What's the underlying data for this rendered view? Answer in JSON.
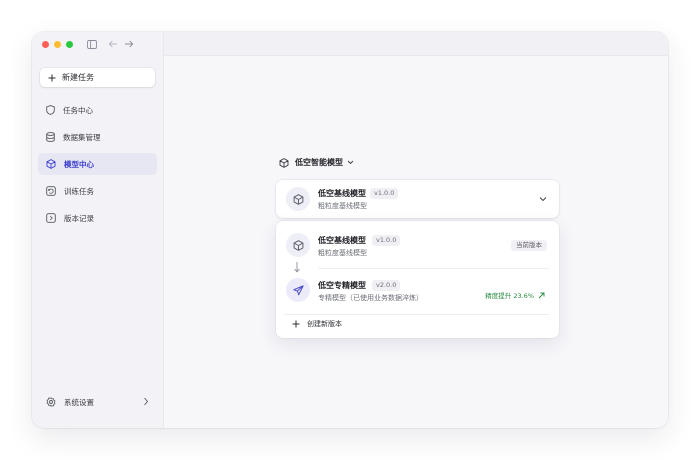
{
  "sidebar": {
    "new_task_label": "新建任务",
    "items": [
      {
        "label": "任务中心",
        "icon": "shield-icon"
      },
      {
        "label": "数据集管理",
        "icon": "database-icon"
      },
      {
        "label": "模型中心",
        "icon": "cube-icon",
        "active": true
      },
      {
        "label": "训练任务",
        "icon": "training-icon"
      },
      {
        "label": "版本记录",
        "icon": "document-icon"
      }
    ],
    "settings_label": "系统设置"
  },
  "model_selector": {
    "label": "低空智能模型"
  },
  "current_model": {
    "name": "低空基线模型",
    "version": "v1.0.0",
    "description": "粗粒度基线模型"
  },
  "versions": [
    {
      "name": "低空基线模型",
      "version": "v1.0.0",
      "description": "粗粒度基线模型",
      "badge": "当前版本"
    },
    {
      "name": "低空专精模型",
      "version": "v2.0.0",
      "description": "专精模型（已使用业务数据淬炼）",
      "gain": "精度提升 23.6%"
    }
  ],
  "create_version_label": "创建新版本",
  "colors": {
    "accent": "#3d3fd0",
    "gain": "#2a8a43",
    "traffic_red": "#fe5f57",
    "traffic_yellow": "#febc2e",
    "traffic_green": "#28c840"
  }
}
